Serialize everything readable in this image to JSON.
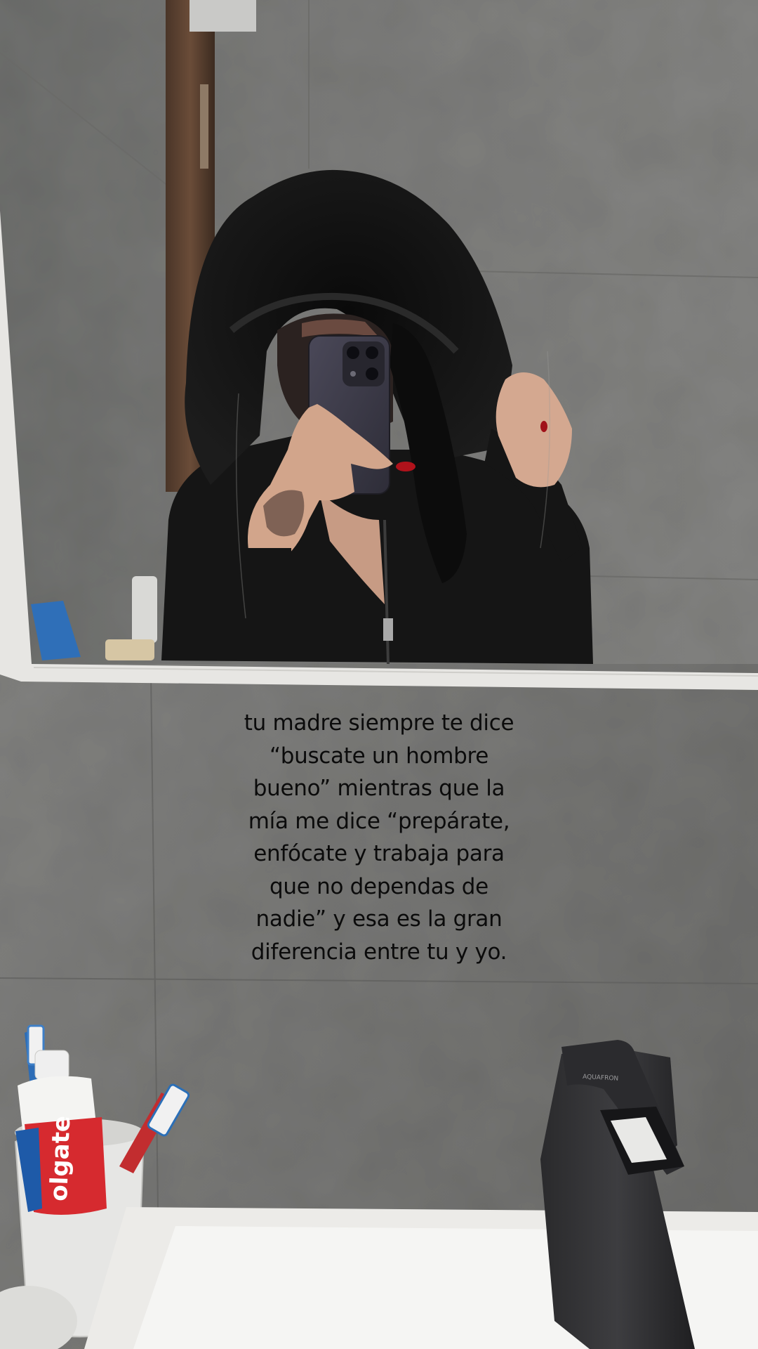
{
  "story": {
    "caption_lines": [
      "tu madre siempre te dice",
      "“buscate un hombre",
      "bueno” mientras que la",
      "mía me dice “prepárate,",
      "enfócate y trabaja para",
      "que no dependas de",
      "nadie” y esa es la gran",
      "diferencia entre tu y yo."
    ],
    "toothpaste_brand": "olgate",
    "faucet_brand": "AQUAFRON"
  },
  "colors": {
    "wall_tile": "#7d7d7b",
    "hoodie": "#161616",
    "mirror_frame": "#ecebe8",
    "toothpaste_red": "#d62a2f",
    "nail_red": "#b0121b",
    "caption_text": "#0b0b0b"
  }
}
